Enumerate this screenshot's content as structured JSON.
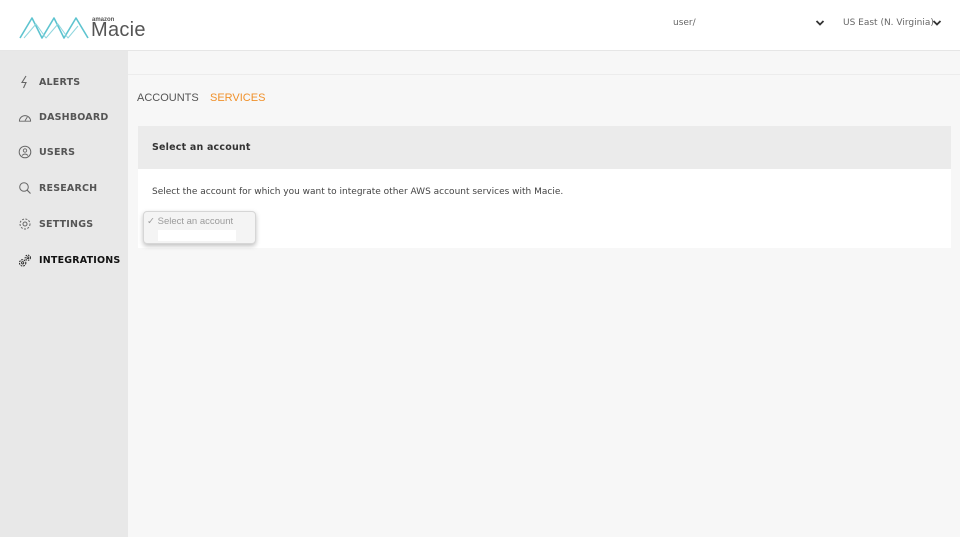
{
  "brand": {
    "amazon": "amazon",
    "name": "Macie"
  },
  "header": {
    "user_label": "user/",
    "region_label": "US East (N. Virginia)"
  },
  "sidebar": {
    "items": [
      {
        "label": "ALERTS",
        "icon": "bolt-icon"
      },
      {
        "label": "DASHBOARD",
        "icon": "gauge-icon"
      },
      {
        "label": "USERS",
        "icon": "user-circle-icon"
      },
      {
        "label": "RESEARCH",
        "icon": "search-icon"
      },
      {
        "label": "SETTINGS",
        "icon": "gear-icon"
      },
      {
        "label": "INTEGRATIONS",
        "icon": "gears-icon",
        "active": true
      }
    ]
  },
  "tabs": [
    {
      "label": "ACCOUNTS",
      "active": false
    },
    {
      "label": "SERVICES",
      "active": true
    }
  ],
  "panel": {
    "title": "Select an account",
    "description": "Select the account for which you want to integrate other AWS account services with Macie."
  },
  "account_select": {
    "selected": "Select an account",
    "check": "✓"
  },
  "colors": {
    "accent": "#f0912b",
    "logo_teal": "#5ec4d0",
    "sidebar_bg": "#e8e8e8"
  }
}
